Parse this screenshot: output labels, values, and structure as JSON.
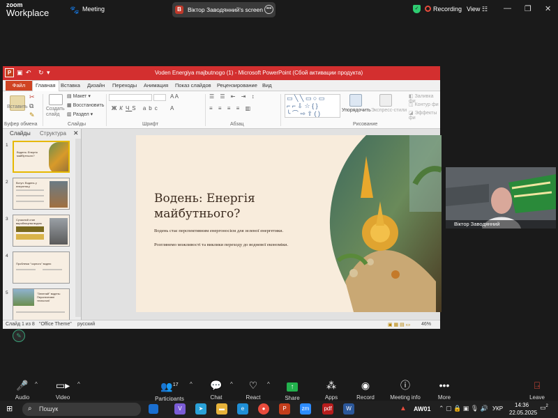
{
  "app": {
    "logo_top": "zoom",
    "logo_bottom": "Workplace",
    "meeting_label": "Meeting"
  },
  "share": {
    "badge": "B",
    "text": "Віктор Заводянний's screen",
    "more": "•••"
  },
  "status": {
    "recording": "Recording",
    "view": "View"
  },
  "window_controls": {
    "minimize": "—",
    "restore": "❐",
    "close": "✕"
  },
  "ppt": {
    "title": "Voden Energiya majbutnogo (1) - Microsoft PowerPoint (Сбой активации продукта)",
    "tabs": [
      "Файл",
      "Главная",
      "Вставка",
      "Дизайн",
      "Переходы",
      "Анимация",
      "Показ слайдов",
      "Рецензирование",
      "Вид"
    ],
    "active_tab": "Главная",
    "ribbon": {
      "paste": "Вставить",
      "new_slide": "Создать слайд",
      "layout": "Макет",
      "reset": "Восстановить",
      "section": "Раздел",
      "arrange": "Упорядочить",
      "quick_styles": "Экспресс-стили",
      "shape_fill": "Заливка фи",
      "shape_outline": "Контур фи",
      "shape_effects": "Эффекты фи",
      "groups": {
        "clipboard": "Буфер обмена",
        "slides": "Слайды",
        "font": "Шрифт",
        "paragraph": "Абзац",
        "drawing": "Рисование"
      }
    },
    "panel_tabs": [
      "Слайды",
      "Структура"
    ],
    "thumbnails": [
      {
        "num": "1",
        "title": "Водень: Енергія майбутнього?"
      },
      {
        "num": "2",
        "title": "Вступ: Водень у енергетиці"
      },
      {
        "num": "3",
        "title": "Сучасний стан виробництва водню"
      },
      {
        "num": "4",
        "title": "Проблеми \"чорного\" водню"
      },
      {
        "num": "5",
        "title": "\"Зелений\" водень: Перспективні технології"
      }
    ],
    "slide": {
      "title": "Водень: Енергія майбутнього?",
      "p1": "Водень стає перспективним енергоносієм для зеленої енергетики.",
      "p2": "Розглянемо можливості та виклики переходу до водневої економіки."
    },
    "statusbar": {
      "slide_count": "Слайд 1 из 8",
      "theme": "\"Office Theme\"",
      "language": "русский",
      "zoom": "46%"
    }
  },
  "camera": {
    "name": "Віктор Заводянний"
  },
  "toolbar": {
    "audio": "Audio",
    "video": "Video",
    "participants": "Participants",
    "participants_count": "17",
    "chat": "Chat",
    "react": "React",
    "share": "Share",
    "apps": "Apps",
    "record": "Record",
    "meeting_info": "Meeting info",
    "more": "More",
    "leave": "Leave"
  },
  "taskbar": {
    "search": "Пошук",
    "app_label": "AW01",
    "lang": "УКР",
    "time": "14:36",
    "date": "22.05.2025",
    "notif": "2"
  }
}
